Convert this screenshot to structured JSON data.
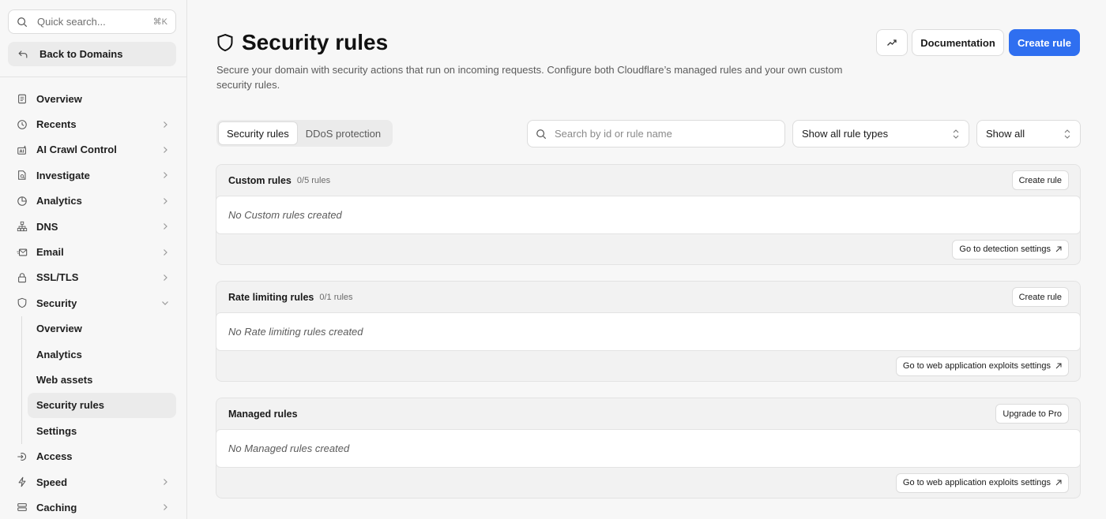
{
  "sidebar": {
    "search": {
      "placeholder": "Quick search...",
      "shortcut": "⌘K"
    },
    "back_label": "Back to Domains",
    "items": [
      {
        "label": "Overview",
        "icon": "clipboard-icon",
        "chevron": false
      },
      {
        "label": "Recents",
        "icon": "clock-icon",
        "chevron": true
      },
      {
        "label": "AI Crawl Control",
        "icon": "ai-icon",
        "chevron": true
      },
      {
        "label": "Investigate",
        "icon": "document-search-icon",
        "chevron": true
      },
      {
        "label": "Analytics",
        "icon": "pie-chart-icon",
        "chevron": true
      },
      {
        "label": "DNS",
        "icon": "network-icon",
        "chevron": true
      },
      {
        "label": "Email",
        "icon": "email-icon",
        "chevron": true
      },
      {
        "label": "SSL/TLS",
        "icon": "lock-icon",
        "chevron": true
      },
      {
        "label": "Security",
        "icon": "shield-icon",
        "chevron": "down"
      }
    ],
    "security_sub": [
      "Overview",
      "Analytics",
      "Web assets",
      "Security rules",
      "Settings"
    ],
    "items_after": [
      {
        "label": "Access",
        "icon": "access-icon",
        "chevron": false
      },
      {
        "label": "Speed",
        "icon": "bolt-icon",
        "chevron": true
      },
      {
        "label": "Caching",
        "icon": "cache-icon",
        "chevron": true
      }
    ]
  },
  "header": {
    "title": "Security rules",
    "description": "Secure your domain with security actions that run on incoming requests. Configure both Cloudflare’s managed rules and your own custom security rules.",
    "documentation_label": "Documentation",
    "create_label": "Create rule"
  },
  "tabs": [
    "Security rules",
    "DDoS protection"
  ],
  "filters": {
    "search_placeholder": "Search by id or rule name",
    "rule_type": "Show all rule types",
    "show": "Show all"
  },
  "cards": [
    {
      "title": "Custom rules",
      "count": "0/5 rules",
      "action": "Create rule",
      "empty": "No Custom rules created",
      "footer": "Go to detection settings"
    },
    {
      "title": "Rate limiting rules",
      "count": "0/1 rules",
      "action": "Create rule",
      "empty": "No Rate limiting rules created",
      "footer": "Go to web application exploits settings"
    },
    {
      "title": "Managed rules",
      "count": "",
      "action": "Upgrade to Pro",
      "empty": "No Managed rules created",
      "footer": "Go to web application exploits settings"
    }
  ],
  "colors": {
    "primary": "#2f6ff0",
    "sidebar_bg": "#f7f7f7",
    "border": "#dcdcdc"
  }
}
